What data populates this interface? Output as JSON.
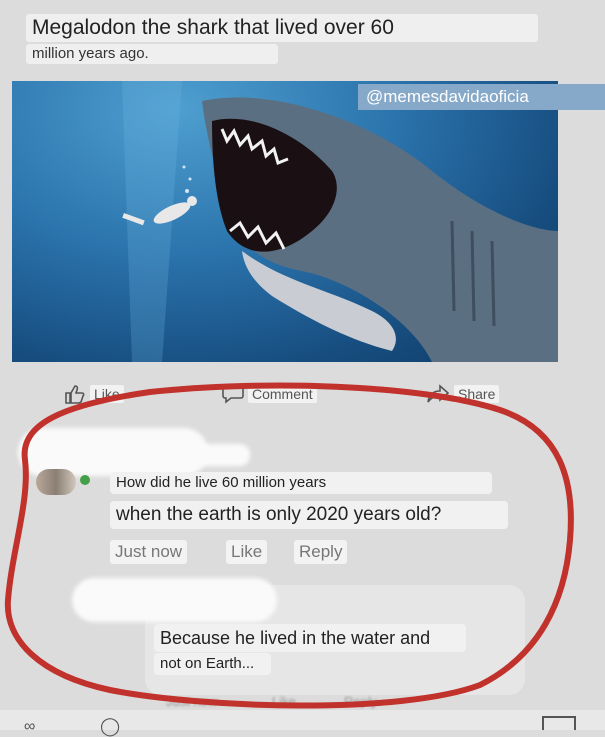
{
  "post": {
    "text_line1": "Megalodon the shark that lived over 60",
    "text_line2": "million years ago.",
    "watermark": "@memesdavidaoficia"
  },
  "actions": {
    "like": "Like",
    "comment": "Comment",
    "share": "Share"
  },
  "comments": [
    {
      "line1": "How did he live 60 million years",
      "line2": "when the earth is only 2020 years old?",
      "time": "Just now",
      "like": "Like",
      "reply": "Reply"
    },
    {
      "line1": "Because he lived in the water and",
      "line2": "not on Earth...",
      "time": "Just now",
      "like": "Like",
      "reply": "Reply"
    }
  ],
  "colors": {
    "annotation_circle": "#c0322b",
    "online_dot": "#43a047"
  }
}
